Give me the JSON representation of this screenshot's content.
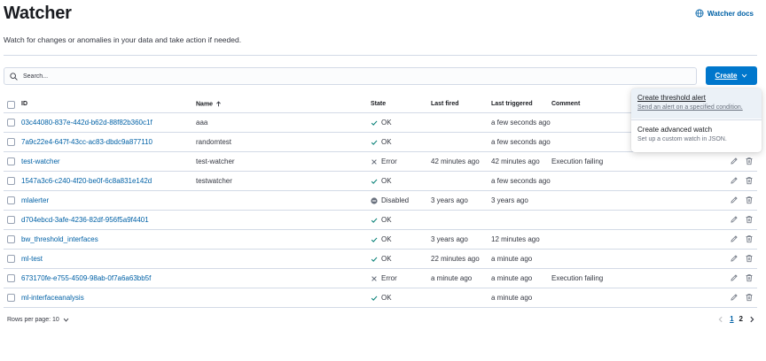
{
  "header": {
    "title": "Watcher",
    "docs_label": "Watcher docs",
    "description": "Watch for changes or anomalies in your data and take action if needed."
  },
  "search": {
    "placeholder": "Search..."
  },
  "create_button": {
    "label": "Create"
  },
  "table": {
    "columns": [
      "ID",
      "Name",
      "State",
      "Last fired",
      "Last triggered",
      "Comment"
    ],
    "rows": [
      {
        "id": "03c44080-837e-442d-b62d-88f82b360c1f",
        "name": "aaa",
        "state": "OK",
        "state_type": "ok",
        "last_fired": "",
        "last_triggered": "a few seconds ago",
        "comment": ""
      },
      {
        "id": "7a9c22e4-647f-43cc-ac83-dbdc9a877110",
        "name": "randomtest",
        "state": "OK",
        "state_type": "ok",
        "last_fired": "",
        "last_triggered": "a few seconds ago",
        "comment": ""
      },
      {
        "id": "test-watcher",
        "name": "test-watcher",
        "state": "Error",
        "state_type": "error",
        "last_fired": "42 minutes ago",
        "last_triggered": "42 minutes ago",
        "comment": "Execution failing"
      },
      {
        "id": "1547a3c6-c240-4f20-be0f-6c8a831e142d",
        "name": "testwatcher",
        "state": "OK",
        "state_type": "ok",
        "last_fired": "",
        "last_triggered": "a few seconds ago",
        "comment": ""
      },
      {
        "id": "mlalerter",
        "name": "",
        "state": "Disabled",
        "state_type": "disabled",
        "last_fired": "3 years ago",
        "last_triggered": "3 years ago",
        "comment": ""
      },
      {
        "id": "d704ebcd-3afe-4236-82df-956f5a9f4401",
        "name": "",
        "state": "OK",
        "state_type": "ok",
        "last_fired": "",
        "last_triggered": "",
        "comment": ""
      },
      {
        "id": "bw_threshold_interfaces",
        "name": "",
        "state": "OK",
        "state_type": "ok",
        "last_fired": "3 years ago",
        "last_triggered": "12 minutes ago",
        "comment": ""
      },
      {
        "id": "ml-test",
        "name": "",
        "state": "OK",
        "state_type": "ok",
        "last_fired": "22 minutes ago",
        "last_triggered": "a minute ago",
        "comment": ""
      },
      {
        "id": "673170fe-e755-4509-98ab-0f7a6a63bb5f",
        "name": "",
        "state": "Error",
        "state_type": "error",
        "last_fired": "a minute ago",
        "last_triggered": "a minute ago",
        "comment": "Execution failing"
      },
      {
        "id": "ml-interfaceanalysis",
        "name": "",
        "state": "OK",
        "state_type": "ok",
        "last_fired": "",
        "last_triggered": "a minute ago",
        "comment": ""
      }
    ]
  },
  "footer": {
    "rows_per_page": "Rows per page: 10",
    "pages": [
      "1",
      "2"
    ],
    "active_page": "1"
  },
  "popover": {
    "items": [
      {
        "title": "Create threshold alert",
        "subtitle": "Send an alert on a specified condition."
      },
      {
        "title": "Create advanced watch",
        "subtitle": "Set up a custom watch in JSON."
      }
    ]
  },
  "colors": {
    "accent": "#0077cc",
    "link": "#0061a6",
    "ok": "#017d73",
    "error": "#69707d",
    "disabled": "#69707d"
  },
  "icons": {
    "docs": "globe-icon",
    "search": "search-icon",
    "sort": "arrow-up-icon",
    "edit": "pencil-icon",
    "delete": "trash-icon"
  }
}
